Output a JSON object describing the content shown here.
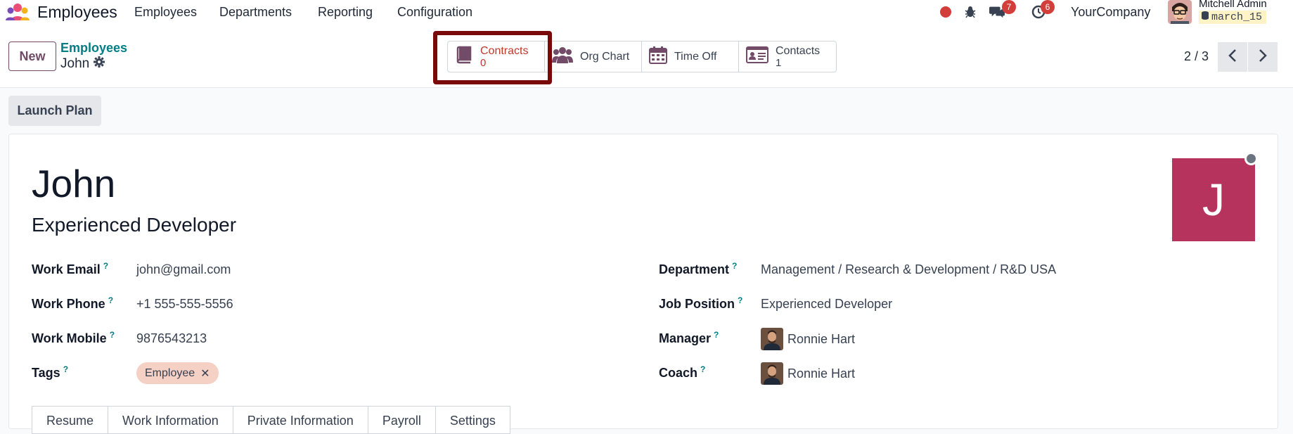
{
  "navbar": {
    "app_name": "Employees",
    "menu": [
      "Employees",
      "Departments",
      "Reporting",
      "Configuration"
    ],
    "messages_count": "7",
    "activities_count": "6",
    "company": "YourCompany",
    "user_name": "Mitchell Admin",
    "database": "march_15",
    "colors": {
      "record_dot": "#d23f3a",
      "badge": "#d23f3a"
    }
  },
  "control_panel": {
    "new_label": "New",
    "breadcrumb_parent": "Employees",
    "breadcrumb_current": "John",
    "smart_buttons": [
      {
        "label": "Contracts",
        "value": "0",
        "icon": "book-icon"
      },
      {
        "label": "Org Chart",
        "value": "",
        "icon": "users-icon"
      },
      {
        "label": "Time Off",
        "value": "",
        "icon": "calendar-icon"
      },
      {
        "label": "Contacts",
        "value": "1",
        "icon": "id-card-icon"
      }
    ],
    "pager": "2 / 3"
  },
  "status_bar": {
    "launch_plan_label": "Launch Plan"
  },
  "form": {
    "name": "John",
    "job_title": "Experienced Developer",
    "photo_initial": "J",
    "photo_color": "#b5335c",
    "fields_left": [
      {
        "label": "Work Email",
        "value": "john@gmail.com"
      },
      {
        "label": "Work Phone",
        "value": "+1 555-555-5556"
      },
      {
        "label": "Work Mobile",
        "value": "9876543213"
      },
      {
        "label": "Tags",
        "value": ""
      }
    ],
    "tag": "Employee",
    "fields_right": [
      {
        "label": "Department",
        "value": "Management / Research & Development / R&D USA"
      },
      {
        "label": "Job Position",
        "value": "Experienced Developer"
      },
      {
        "label": "Manager",
        "value": "Ronnie Hart"
      },
      {
        "label": "Coach",
        "value": "Ronnie Hart"
      }
    ],
    "help_mark": "?",
    "tabs": [
      "Resume",
      "Work Information",
      "Private Information",
      "Payroll",
      "Settings"
    ]
  }
}
